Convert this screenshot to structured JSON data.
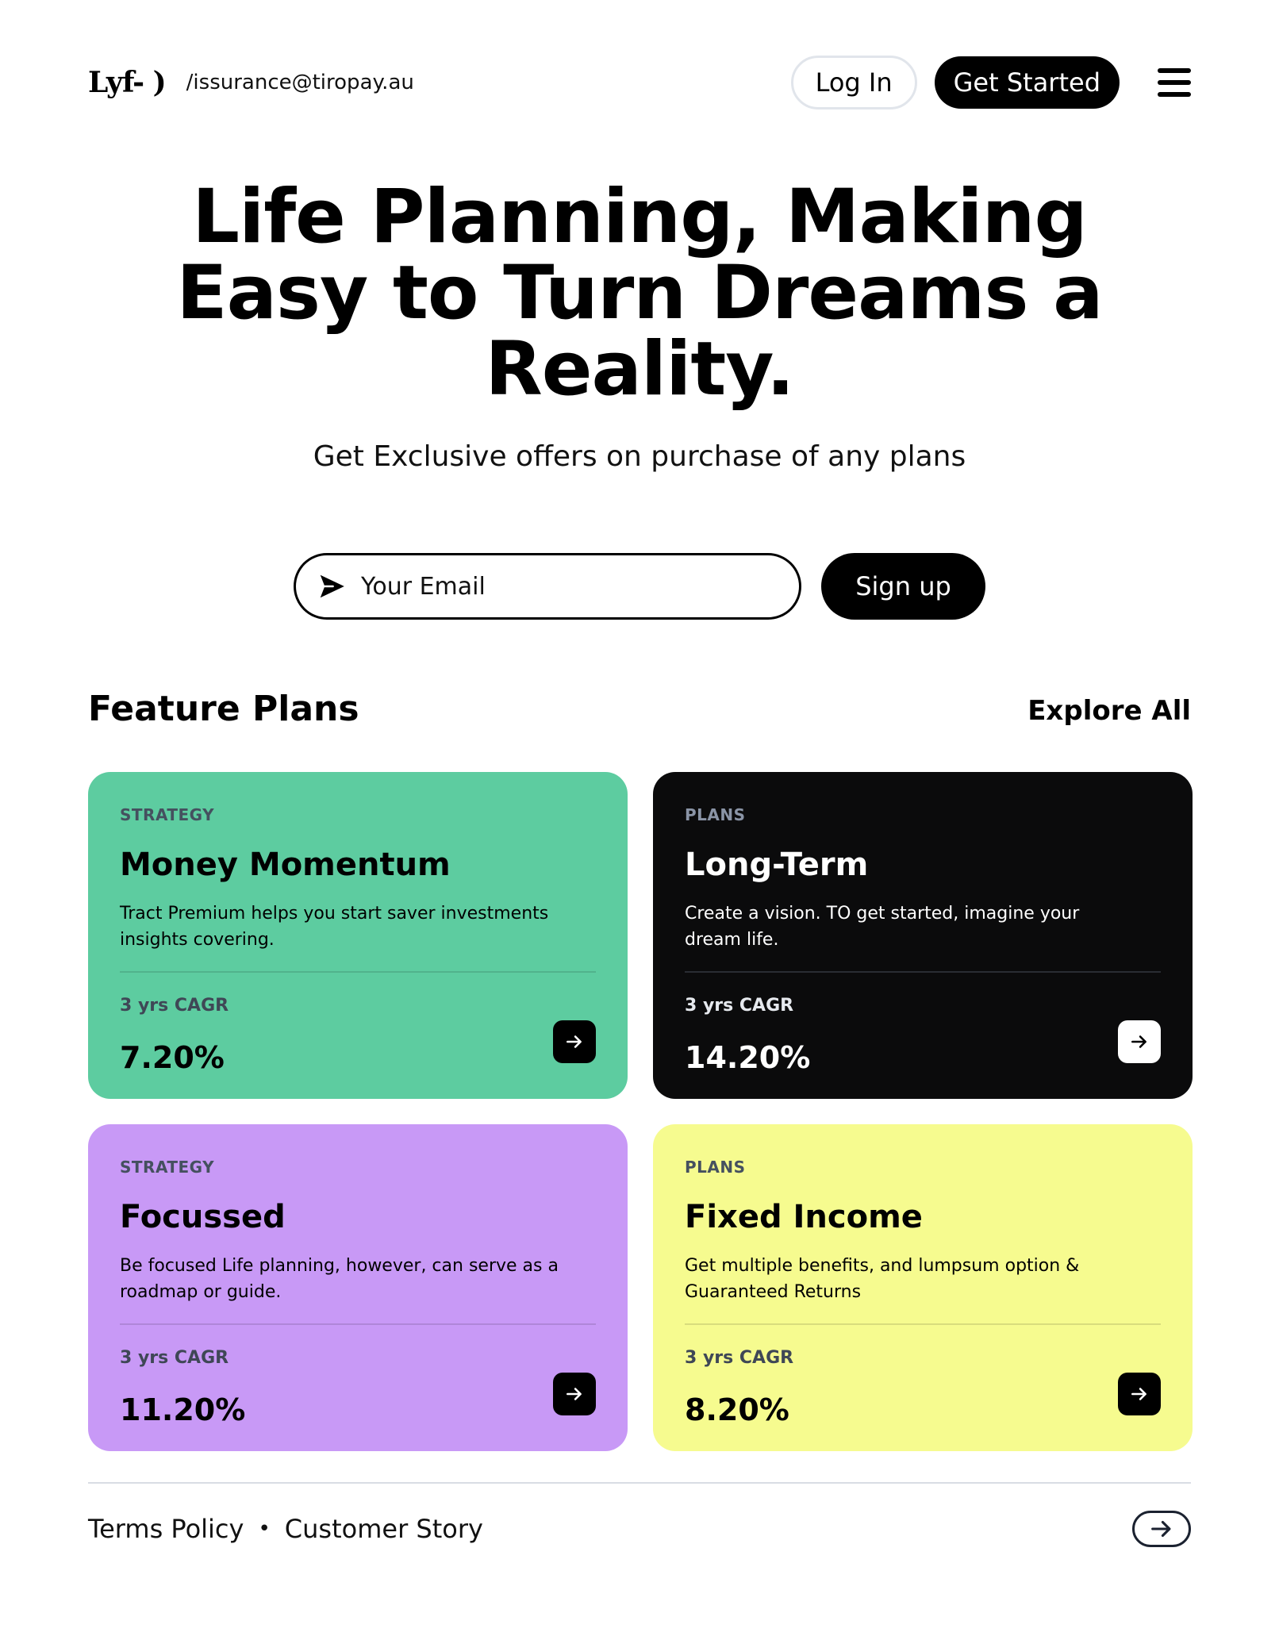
{
  "header": {
    "logo": "Lyf- )",
    "email": "/issurance@tiropay.au",
    "login_label": "Log In",
    "get_started_label": "Get Started"
  },
  "hero": {
    "title": "Life Planning, Making Easy to Turn Dreams a Reality.",
    "subtitle": "Get Exclusive offers on purchase of any plans"
  },
  "signup": {
    "email_placeholder": "Your Email",
    "button_label": "Sign up"
  },
  "features": {
    "title": "Feature Plans",
    "explore_label": "Explore All",
    "cards": [
      {
        "kicker": "STRATEGY",
        "title": "Money Momentum",
        "description": "Tract Premium helps you start saver investments insights covering.",
        "cagr_label": "3 yrs CAGR",
        "cagr_value": "7.20%",
        "color": "#5dcca0"
      },
      {
        "kicker": "PLANS",
        "title": "Long-Term",
        "description": "Create a vision. TO get started, imagine your dream life.",
        "cagr_label": "3 yrs CAGR",
        "cagr_value": "14.20%",
        "color": "#0b0b0c"
      },
      {
        "kicker": "STRATEGY",
        "title": "Focussed",
        "description": "Be focused Life planning, however, can serve as a roadmap or guide.",
        "cagr_label": "3 yrs CAGR",
        "cagr_value": "11.20%",
        "color": "#c899f6"
      },
      {
        "kicker": "PLANS",
        "title": "Fixed Income",
        "description": "Get multiple benefits, and lumpsum option & Guaranteed Returns",
        "cagr_label": "3 yrs CAGR",
        "cagr_value": "8.20%",
        "color": "#f6fb8f"
      }
    ]
  },
  "footer": {
    "terms_label": "Terms Policy",
    "separator": "•",
    "customer_story_label": "Customer Story"
  },
  "icons": {
    "menu": "hamburger-menu-icon",
    "send": "send-icon",
    "arrow": "arrow-right-icon"
  }
}
